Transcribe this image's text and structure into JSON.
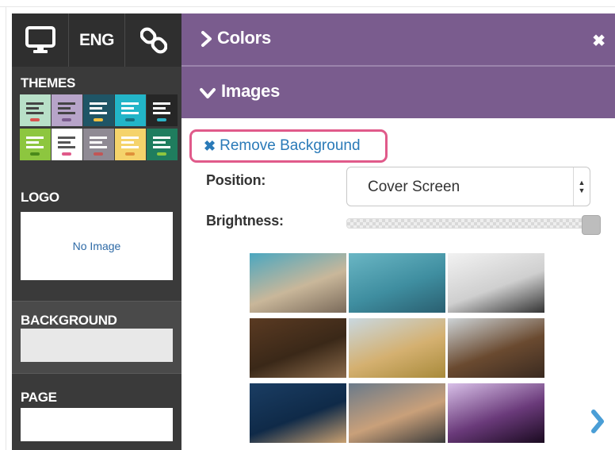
{
  "sidebar": {
    "lang_label": "ENG",
    "themes_label": "THEMES",
    "logo_label": "LOGO",
    "logo_placeholder": "No Image",
    "background_label": "BACKGROUND",
    "page_label": "PAGE"
  },
  "themes": [
    {
      "bg": "#b8e0c8",
      "stripe": "#444",
      "dot": "#d9534f"
    },
    {
      "bg": "#b7a4c9",
      "stripe": "#444",
      "dot": "#7a5c8e"
    },
    {
      "bg": "#1f5566",
      "stripe": "#fff",
      "dot": "#f0c040"
    },
    {
      "bg": "#22b5c8",
      "stripe": "#fff",
      "dot": "#1a6f80"
    },
    {
      "bg": "#262626",
      "stripe": "#fff",
      "dot": "#2bb5c8"
    },
    {
      "bg": "#8dc63f",
      "stripe": "#fff",
      "dot": "#4a8a1a"
    },
    {
      "bg": "#ffffff",
      "stripe": "#555",
      "dot": "#e05a8a"
    },
    {
      "bg": "#8f8a94",
      "stripe": "#fff",
      "dot": "#c25656"
    },
    {
      "bg": "#f5d36b",
      "stripe": "#fff",
      "dot": "#e0913a"
    },
    {
      "bg": "#1f7d5e",
      "stripe": "#fff",
      "dot": "#8dc63f"
    }
  ],
  "panel": {
    "colors_title": "Colors",
    "images_title": "Images",
    "remove_bg_label": "Remove Background",
    "position_label": "Position:",
    "position_value": "Cover Screen",
    "brightness_label": "Brightness:",
    "brightness_value": 1.0
  },
  "images": [
    {
      "name": "beach-cliffs",
      "colors": [
        "#4ba7c0",
        "#c9b79a",
        "#7a6a5a"
      ]
    },
    {
      "name": "cable-cars",
      "colors": [
        "#6ab6c4",
        "#3f8ea0",
        "#2a5f70"
      ]
    },
    {
      "name": "foggy-horizon",
      "colors": [
        "#f2f2f2",
        "#cfcfcf",
        "#333333"
      ]
    },
    {
      "name": "table-flatlay",
      "colors": [
        "#5a3a22",
        "#3a2818",
        "#8a6a4a"
      ]
    },
    {
      "name": "field-tree",
      "colors": [
        "#c9d8e0",
        "#d4b070",
        "#a88a3a"
      ]
    },
    {
      "name": "brown-bear",
      "colors": [
        "#cdd3d6",
        "#6a4a30",
        "#3a2a20"
      ]
    },
    {
      "name": "ocean-pier",
      "colors": [
        "#1a3d63",
        "#0f2a48",
        "#c9a070"
      ]
    },
    {
      "name": "dusk-mountain",
      "colors": [
        "#6a7a8a",
        "#c9a07a",
        "#3a3a3a"
      ]
    },
    {
      "name": "purple-bokeh",
      "colors": [
        "#d8c0e8",
        "#6a3a7a",
        "#1a0a20"
      ]
    }
  ]
}
